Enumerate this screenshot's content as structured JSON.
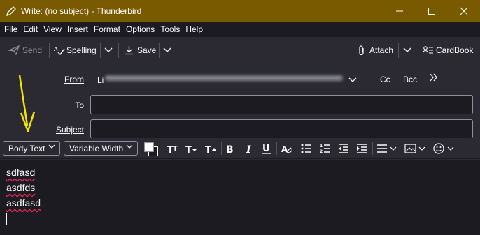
{
  "window": {
    "title": "Write: (no subject) - Thunderbird"
  },
  "menu": [
    {
      "key": "F",
      "rest": "ile"
    },
    {
      "key": "E",
      "rest": "dit"
    },
    {
      "key": "V",
      "rest": "iew"
    },
    {
      "key": "I",
      "rest": "nsert"
    },
    {
      "key": "F",
      "rest": "ormat"
    },
    {
      "key": "O",
      "rest": "ptions"
    },
    {
      "key": "T",
      "rest": "ools"
    },
    {
      "key": "H",
      "rest": "elp"
    }
  ],
  "toolbar": {
    "send": "Send",
    "spelling": "Spelling",
    "save": "Save",
    "attach": "Attach",
    "cardbook": "CardBook"
  },
  "header": {
    "from_label": "From",
    "from_value": "Li",
    "cc": "Cc",
    "bcc": "Bcc",
    "to_label": "To",
    "subject_label": "Subject"
  },
  "format": {
    "paragraph": "Body Text",
    "font": "Variable Width"
  },
  "body": {
    "lines": [
      "sdfasd",
      "asdfds",
      "asdfasd"
    ]
  },
  "colors": {
    "titlebar": "#7a5a00",
    "arrow": "#f5e600",
    "spellcheck": "#e22850"
  }
}
